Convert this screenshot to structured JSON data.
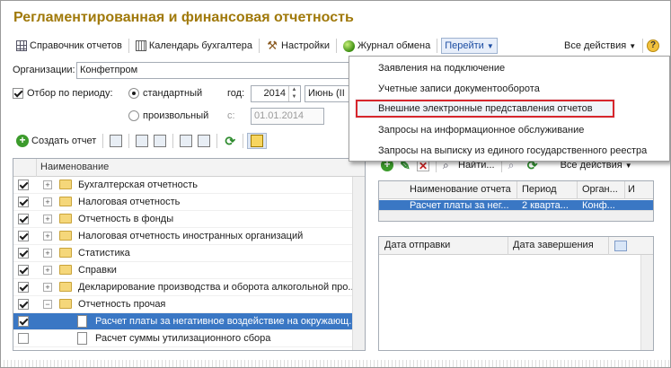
{
  "title": "Регламентированная и финансовая отчетность",
  "toolbar": {
    "items": [
      "Справочник отчетов",
      "Календарь бухгалтера",
      "Настройки",
      "Журнал обмена"
    ],
    "goto": "Перейти",
    "all_actions": "Все действия",
    "help": "?"
  },
  "org": {
    "label": "Организации:",
    "value": "Конфетпром"
  },
  "period": {
    "filter_label": "Отбор по периоду:",
    "standard": "стандартный",
    "arbitrary": "произвольный",
    "year_label": "год:",
    "year": "2014",
    "month": "Июнь (II",
    "from_label": "с:",
    "from": "01.01.2014"
  },
  "actions": {
    "create": "Создать отчет"
  },
  "grid": {
    "header": "Наименование",
    "rows": [
      {
        "label": "Бухгалтерская отчетность",
        "checked": true,
        "kind": "folder",
        "exp": "+"
      },
      {
        "label": "Налоговая отчетность",
        "checked": true,
        "kind": "folder",
        "exp": "+"
      },
      {
        "label": "Отчетность в фонды",
        "checked": true,
        "kind": "folder",
        "exp": "+"
      },
      {
        "label": "Налоговая отчетность иностранных организаций",
        "checked": true,
        "kind": "folder",
        "exp": "+"
      },
      {
        "label": "Статистика",
        "checked": true,
        "kind": "folder",
        "exp": "+"
      },
      {
        "label": "Справки",
        "checked": true,
        "kind": "folder",
        "exp": "+"
      },
      {
        "label": "Декларирование производства и оборота алкогольной про...",
        "checked": true,
        "kind": "folder",
        "exp": "+"
      },
      {
        "label": "Отчетность прочая",
        "checked": true,
        "kind": "folder",
        "exp": "−"
      },
      {
        "label": "Расчет платы за негативное воздействие на окружающ...",
        "checked": true,
        "kind": "doc",
        "selected": true
      },
      {
        "label": "Расчет суммы утилизационного сбора",
        "checked": false,
        "kind": "doc"
      }
    ]
  },
  "right": {
    "find": "Найти...",
    "all_actions": "Все действия",
    "cols": [
      "Наименование отчета",
      "Период",
      "Орган...",
      "И"
    ],
    "row": [
      "Расчет платы за нег...",
      "2 кварта...",
      "Конф..."
    ],
    "send_cols": [
      "Дата отправки",
      "Дата завершения"
    ]
  },
  "menu": {
    "items": [
      "Заявления на подключение",
      "Учетные записи документооборота",
      "Внешние электронные представления отчетов",
      "Запросы на информационное обслуживание",
      "Запросы на выписку из единого государственного реестра"
    ],
    "highlighted": 2
  }
}
